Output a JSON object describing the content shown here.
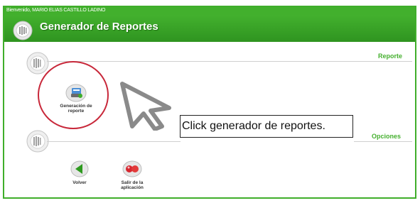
{
  "header": {
    "welcome_text": "Bienvenido, MARIO ELIAS CASTILLO LADINO",
    "title": "Generador de Reportes"
  },
  "sections": {
    "reporte_label": "Reporte",
    "opciones_label": "Opciones"
  },
  "actions": {
    "generate_report_label": "Generación de reporte",
    "back_label": "Volver",
    "exit_label": "Salir de la aplicación"
  },
  "annotation": {
    "instruction_text": "Click generador de reportes."
  },
  "colors": {
    "brand_green": "#3fae2a",
    "highlight_red": "#c8283a"
  }
}
